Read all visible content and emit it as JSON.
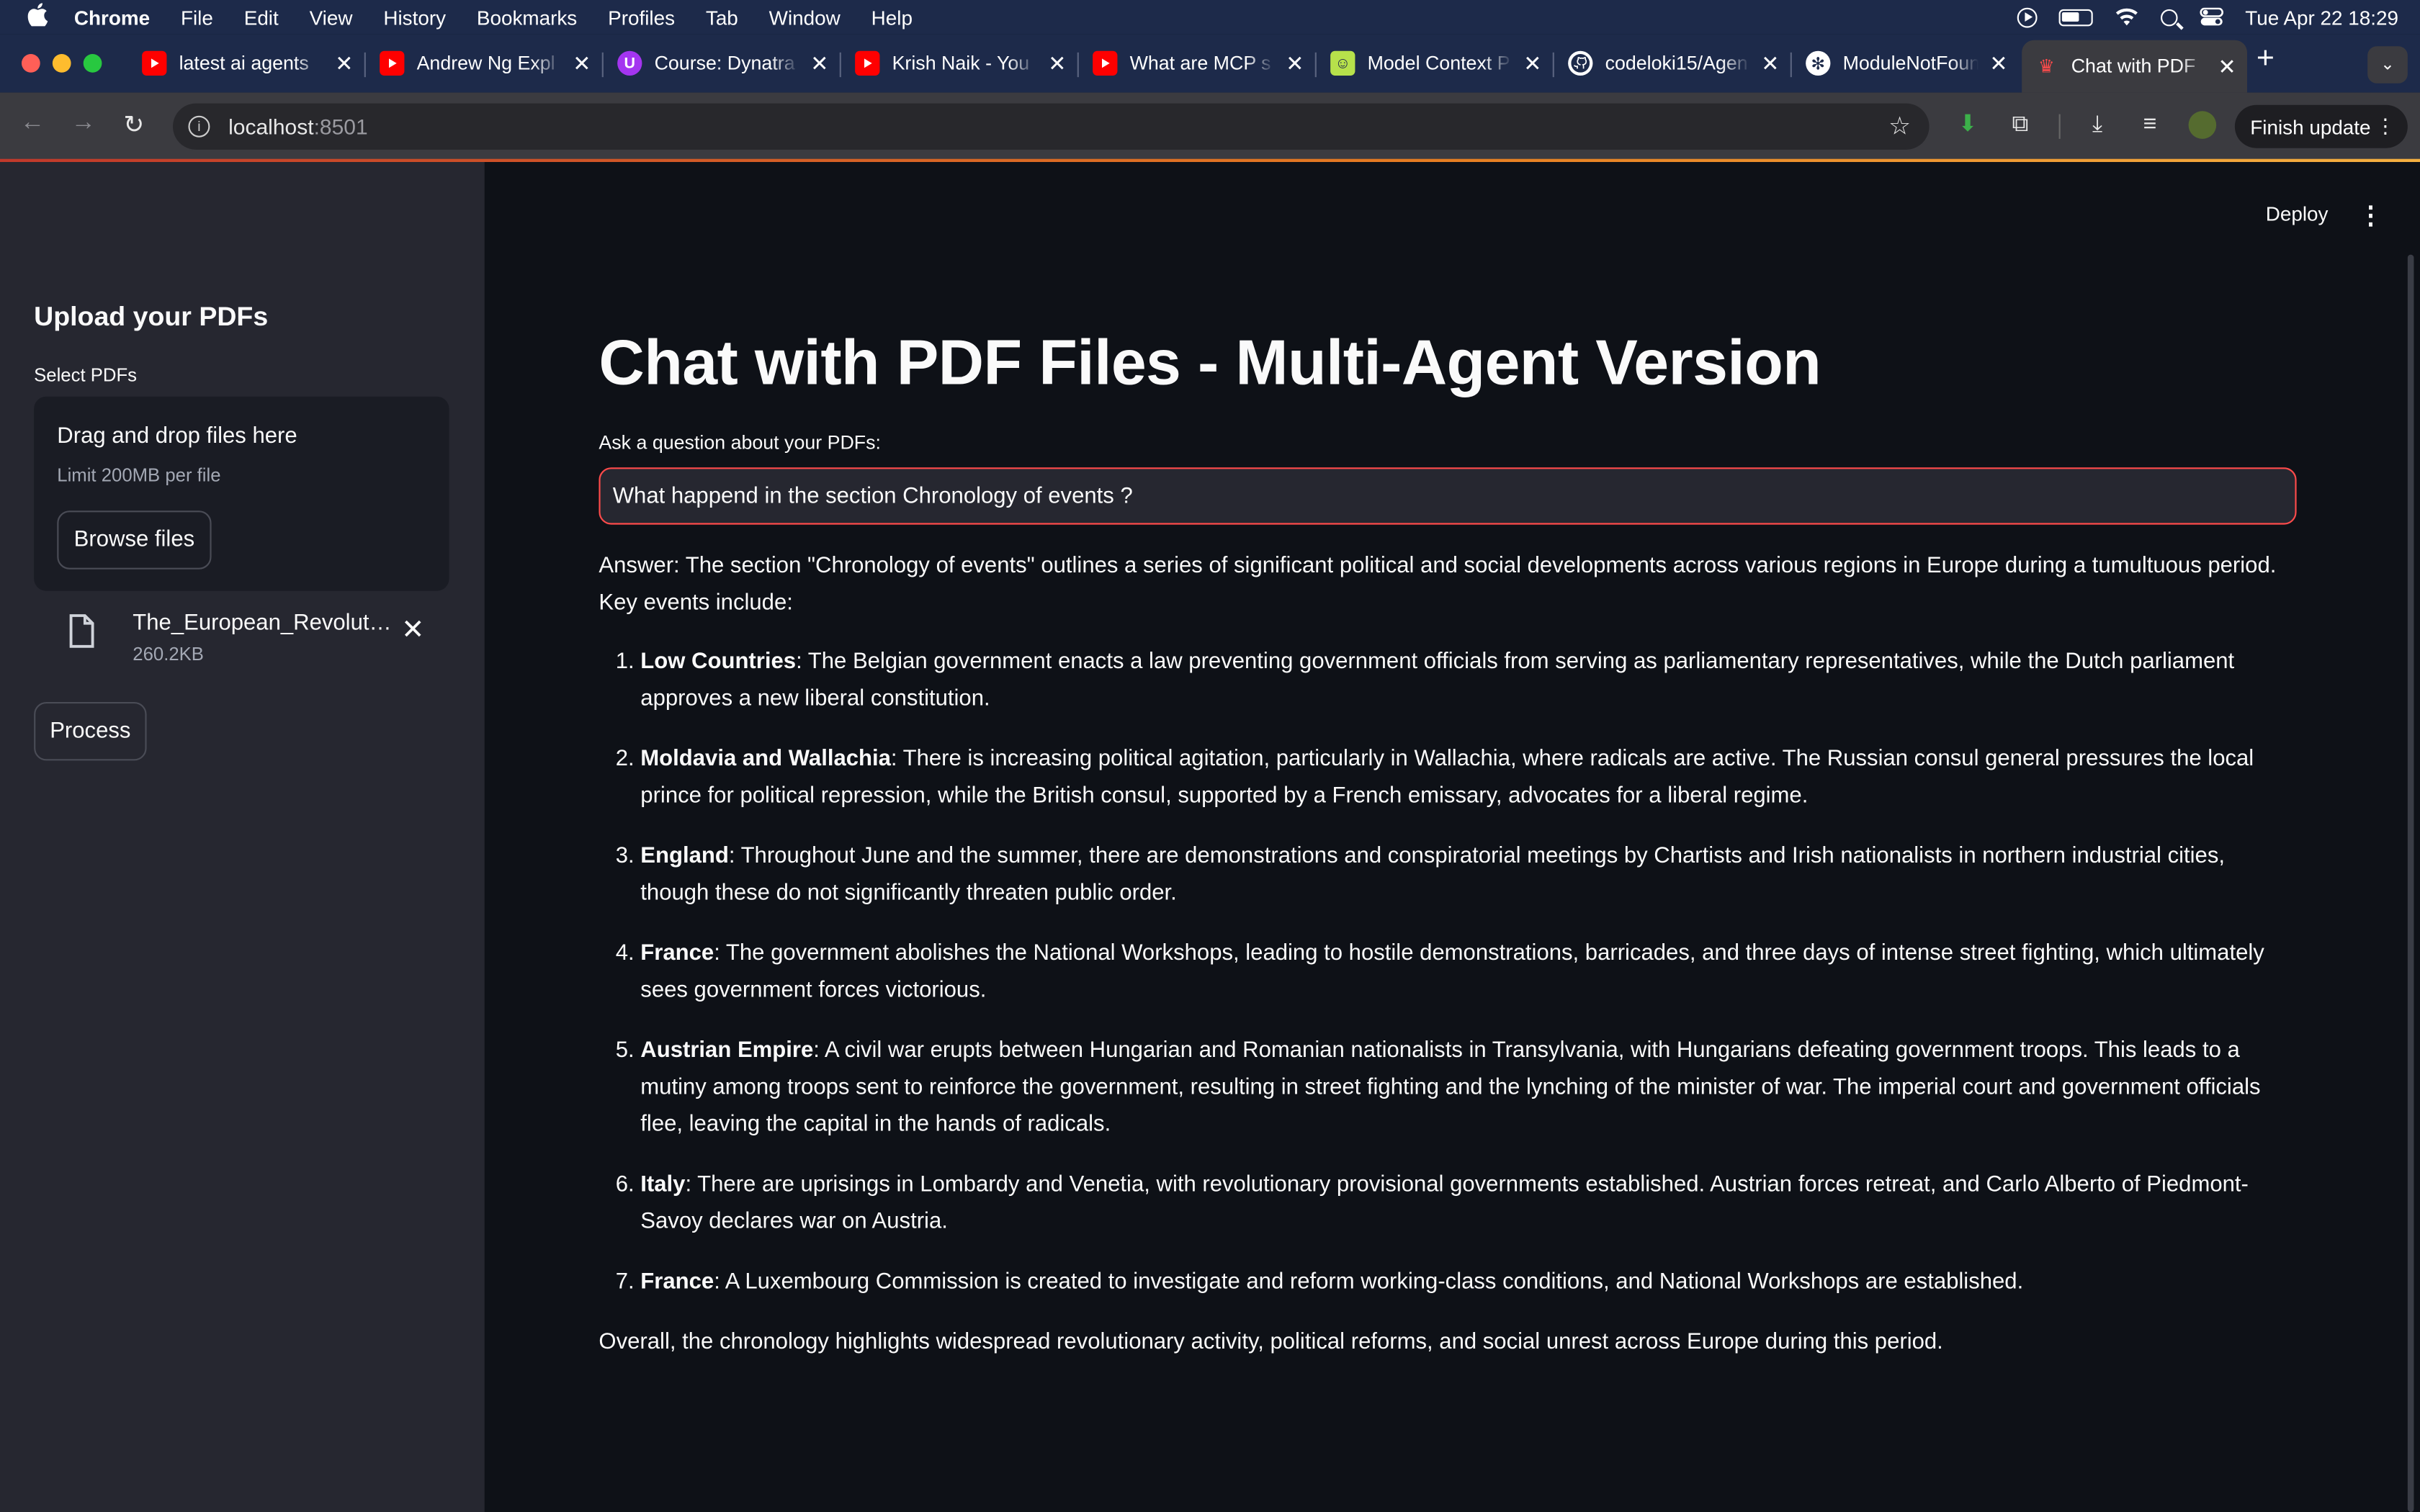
{
  "menubar": {
    "app_name": "Chrome",
    "items": [
      "File",
      "Edit",
      "View",
      "History",
      "Bookmarks",
      "Profiles",
      "Tab",
      "Window",
      "Help"
    ],
    "clock": "Tue Apr 22  18:29"
  },
  "tabs": [
    {
      "label": "latest ai agents",
      "favicon": "youtube-icon",
      "color": "#ff0000"
    },
    {
      "label": "Andrew Ng Expl",
      "favicon": "youtube-icon",
      "color": "#ff0000"
    },
    {
      "label": "Course: Dynatra",
      "favicon": "udemy-icon",
      "color": "#a435f0"
    },
    {
      "label": "Krish Naik - You",
      "favicon": "youtube-icon",
      "color": "#ff0000"
    },
    {
      "label": "What are MCP s",
      "favicon": "youtube-icon",
      "color": "#ff0000"
    },
    {
      "label": "Model Context P",
      "favicon": "smiley-icon",
      "color": "#b7e14b"
    },
    {
      "label": "codeloki15/Agen",
      "favicon": "github-icon",
      "color": "#ffffff"
    },
    {
      "label": "ModuleNotFoun",
      "favicon": "openai-icon",
      "color": "#ffffff"
    },
    {
      "label": "Chat with PDF",
      "favicon": "streamlit-icon",
      "color": "#ff4b4b",
      "active": true
    }
  ],
  "toolbar": {
    "url_host": "localhost",
    "url_port": ":8501",
    "finish_update_label": "Finish update"
  },
  "sidebar": {
    "title": "Upload your PDFs",
    "select_label": "Select PDFs",
    "dropzone_title": "Drag and drop files here",
    "dropzone_limit": "Limit 200MB per file",
    "browse_label": "Browse files",
    "file": {
      "name": "The_European_Revoluti…",
      "size": "260.2KB"
    },
    "process_label": "Process"
  },
  "main": {
    "deploy_label": "Deploy",
    "title": "Chat with PDF Files - Multi-Agent Version",
    "ask_label": "Ask a question about your PDFs:",
    "question": "What happend in the section Chronology of events ?",
    "answer_intro": "Answer: The section \"Chronology of events\" outlines a series of significant political and social developments across various regions in Europe during a tumultuous period. Key events include:",
    "items": [
      {
        "region": "Low Countries",
        "text": ": The Belgian government enacts a law preventing government officials from serving as parliamentary representatives, while the Dutch parliament approves a new liberal constitution."
      },
      {
        "region": "Moldavia and Wallachia",
        "text": ": There is increasing political agitation, particularly in Wallachia, where radicals are active. The Russian consul general pressures the local prince for political repression, while the British consul, supported by a French emissary, advocates for a liberal regime."
      },
      {
        "region": "England",
        "text": ": Throughout June and the summer, there are demonstrations and conspiratorial meetings by Chartists and Irish nationalists in northern industrial cities, though these do not significantly threaten public order."
      },
      {
        "region": "France",
        "text": ": The government abolishes the National Workshops, leading to hostile demonstrations, barricades, and three days of intense street fighting, which ultimately sees government forces victorious."
      },
      {
        "region": "Austrian Empire",
        "text": ": A civil war erupts between Hungarian and Romanian nationalists in Transylvania, with Hungarians defeating government troops. This leads to a mutiny among troops sent to reinforce the government, resulting in street fighting and the lynching of the minister of war. The imperial court and government officials flee, leaving the capital in the hands of radicals."
      },
      {
        "region": "Italy",
        "text": ": There are uprisings in Lombardy and Venetia, with revolutionary provisional governments established. Austrian forces retreat, and Carlo Alberto of Piedmont-Savoy declares war on Austria."
      },
      {
        "region": "France",
        "text": ": A Luxembourg Commission is created to investigate and reform working-class conditions, and National Workshops are established."
      }
    ],
    "answer_closing": "Overall, the chronology highlights widespread revolutionary activity, political reforms, and social unrest across Europe during this period."
  },
  "colors": {
    "accent": "#ff4b4b",
    "app_bg": "#0e1117",
    "sidebar_bg": "#262730",
    "chrome_frame": "#1d2a4a"
  }
}
